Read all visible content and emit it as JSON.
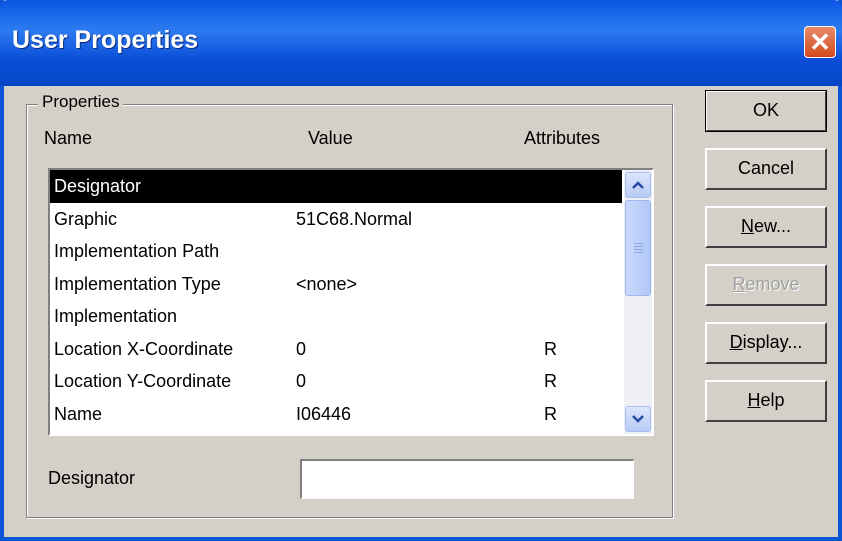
{
  "window": {
    "title": "User Properties"
  },
  "properties": {
    "group_label": "Properties",
    "columns": {
      "name": "Name",
      "value": "Value",
      "attributes": "Attributes"
    },
    "rows": [
      {
        "name": "Designator",
        "value": "",
        "attributes": "",
        "selected": true
      },
      {
        "name": "Graphic",
        "value": "51C68.Normal",
        "attributes": ""
      },
      {
        "name": "Implementation Path",
        "value": "",
        "attributes": ""
      },
      {
        "name": "Implementation Type",
        "value": "<none>",
        "attributes": ""
      },
      {
        "name": "Implementation",
        "value": "",
        "attributes": ""
      },
      {
        "name": "Location X-Coordinate",
        "value": "0",
        "attributes": "R"
      },
      {
        "name": "Location Y-Coordinate",
        "value": "0",
        "attributes": "R"
      },
      {
        "name": "Name",
        "value": "I06446",
        "attributes": "R"
      }
    ]
  },
  "field": {
    "label": "Designator",
    "value": ""
  },
  "buttons": {
    "ok": "OK",
    "cancel": "Cancel",
    "new_first": "N",
    "new_rest": "ew...",
    "remove_first": "R",
    "remove_rest": "emove",
    "display_first": "D",
    "display_rest": "isplay...",
    "help_first": "H",
    "help_rest": "elp"
  },
  "colors": {
    "titlebar": "#0a56e5",
    "selection": "#000000",
    "dialog": "#d4d0c8",
    "close_button": "#d24a1c"
  }
}
